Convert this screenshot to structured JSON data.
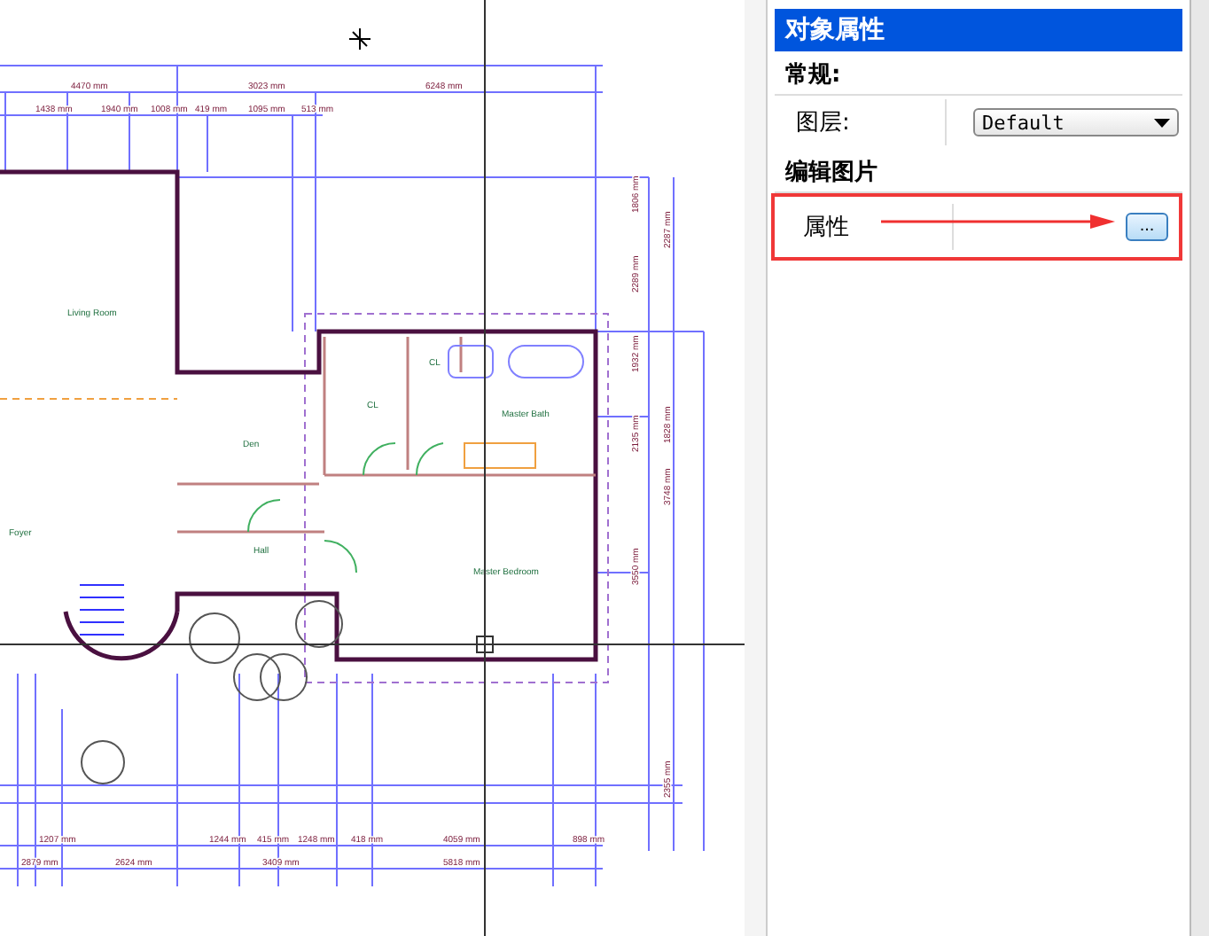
{
  "drawing": {
    "room_labels": [
      "Living Room",
      "Den",
      "CL",
      "CL",
      "Master Bath",
      "Hall",
      "Master Bedroom",
      "Foyer"
    ],
    "top_dimensions": [
      "4470 mm",
      "3023 mm",
      "6248 mm",
      "1438 mm",
      "1940 mm",
      "1008 mm",
      "419 mm",
      "1095 mm",
      "513 mm"
    ],
    "side_dimensions": [
      "1806 mm",
      "2287 mm",
      "2289 mm",
      "1932 mm",
      "2135 mm",
      "3748 mm",
      "3550 mm",
      "1828 mm",
      "2355 mm"
    ],
    "bottom_dimensions": [
      "1207 mm",
      "1244 mm",
      "415 mm",
      "1248 mm",
      "418 mm",
      "4059 mm",
      "898 mm",
      "2879 mm",
      "2624 mm",
      "3409 mm",
      "5818 mm"
    ]
  },
  "panel": {
    "title": "对象属性",
    "sections": [
      {
        "heading": "常规:",
        "rows": [
          {
            "label": "图层:",
            "kind": "dropdown",
            "value": "Default",
            "highlighted": false
          }
        ]
      },
      {
        "heading": "编辑图片",
        "rows": [
          {
            "label": "属性",
            "kind": "button",
            "value": "...",
            "highlighted": true
          }
        ]
      }
    ]
  }
}
